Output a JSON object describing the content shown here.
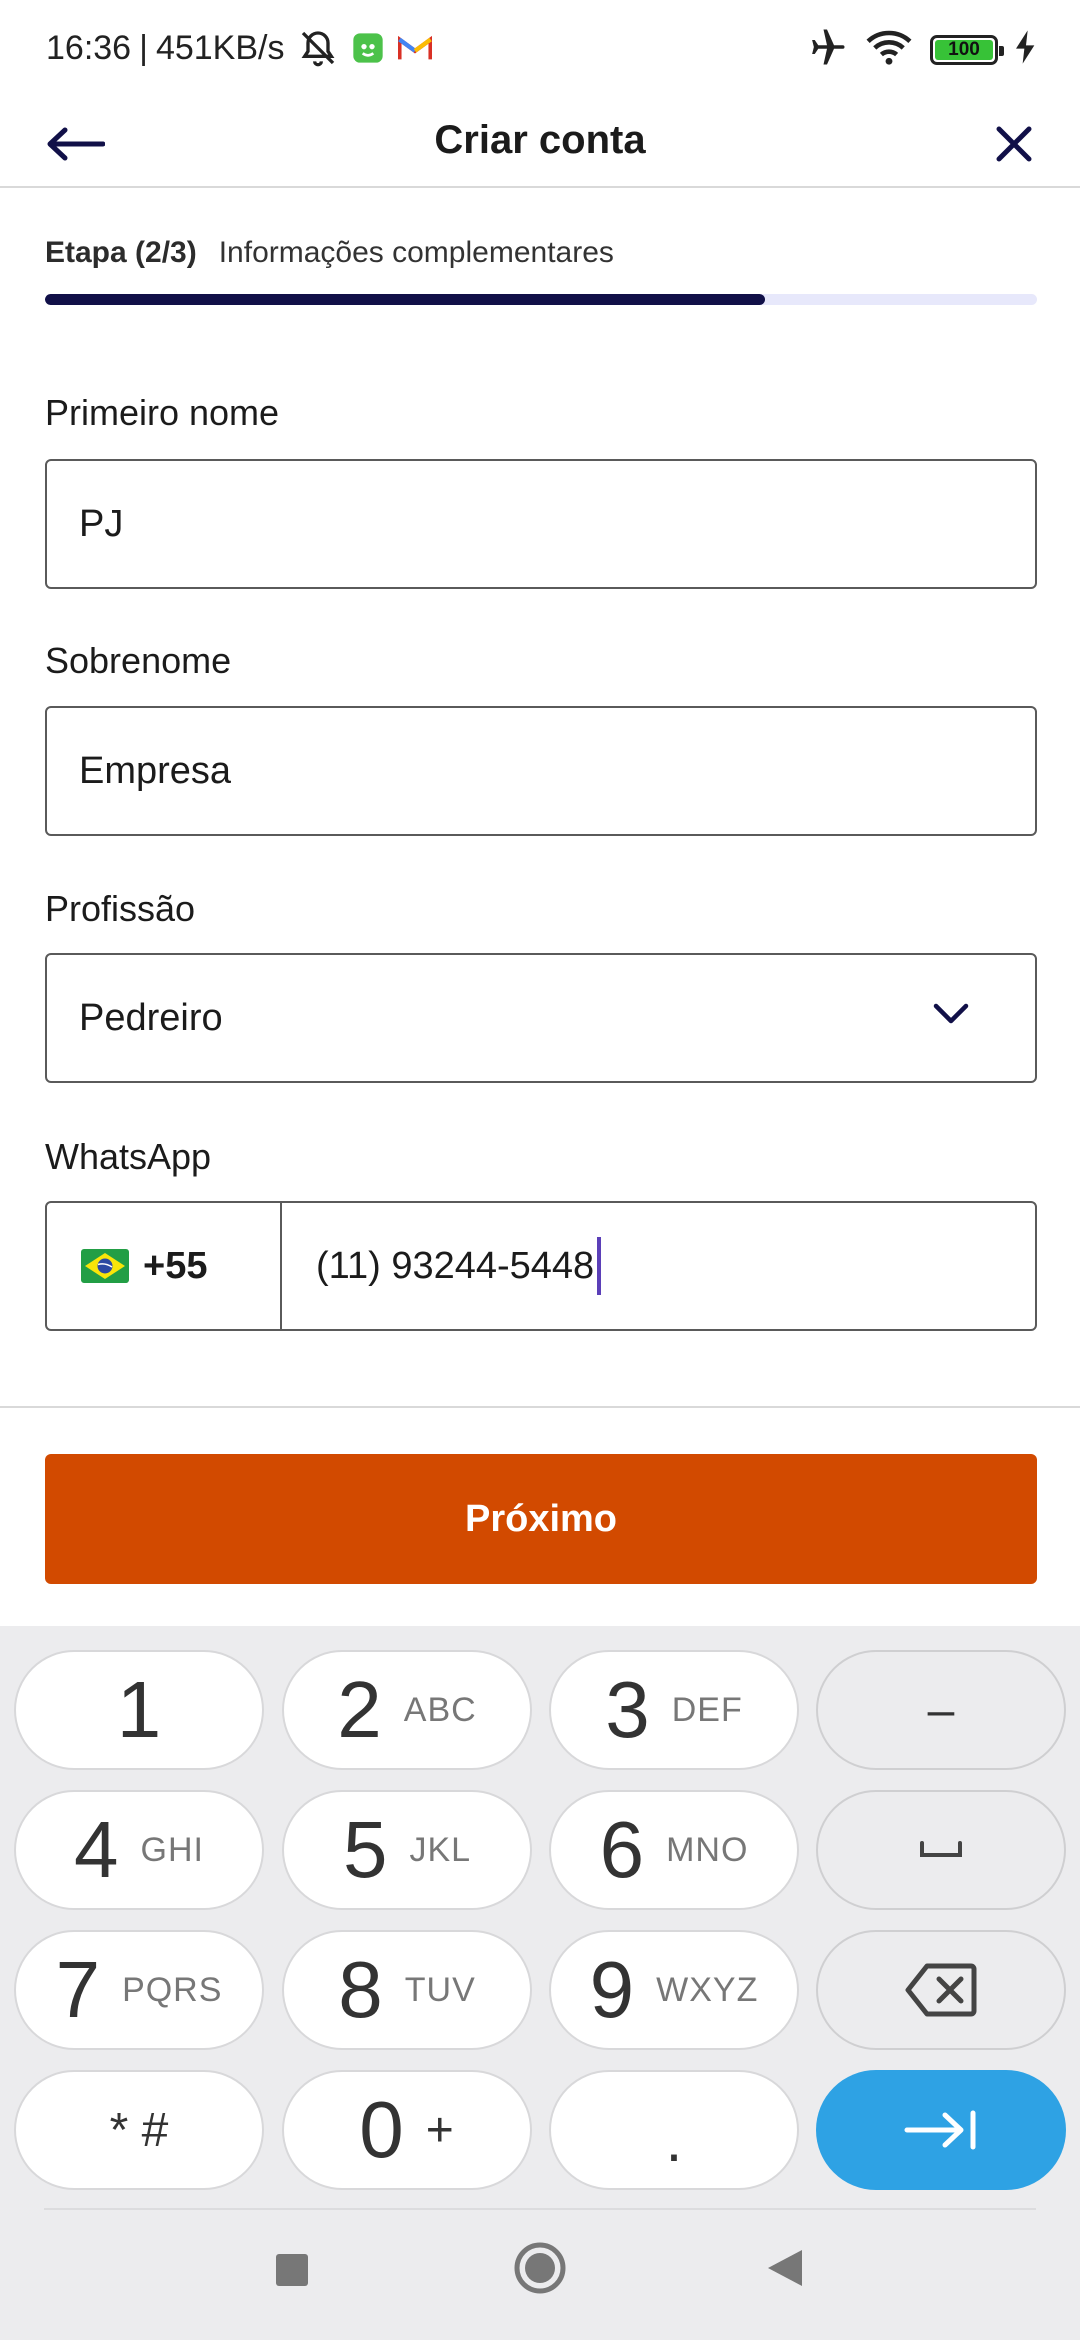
{
  "status_bar": {
    "time": "16:36",
    "network_speed": "451KB/s",
    "battery": "100",
    "battery_level": 1.0
  },
  "header": {
    "title": "Criar conta"
  },
  "step": {
    "number": "Etapa (2/3)",
    "description": "Informações complementares",
    "progress": 0.726
  },
  "form": {
    "first_name": {
      "label": "Primeiro nome",
      "value": "PJ"
    },
    "last_name": {
      "label": "Sobrenome",
      "value": "Empresa"
    },
    "profession": {
      "label": "Profissão",
      "value": "Pedreiro"
    },
    "whatsapp": {
      "label": "WhatsApp",
      "country_code": "+55",
      "number": "(11) 93244-5448"
    }
  },
  "next_button": {
    "label": "Próximo"
  },
  "keyboard": {
    "keys": [
      {
        "digit": "1",
        "letters": ""
      },
      {
        "digit": "2",
        "letters": "ABC"
      },
      {
        "digit": "3",
        "letters": "DEF"
      },
      {
        "digit": "4",
        "letters": "GHI"
      },
      {
        "digit": "5",
        "letters": "JKL"
      },
      {
        "digit": "6",
        "letters": "MNO"
      },
      {
        "digit": "7",
        "letters": "PQRS"
      },
      {
        "digit": "8",
        "letters": "TUV"
      },
      {
        "digit": "9",
        "letters": "WXYZ"
      }
    ],
    "minus": "–",
    "star_hash": "* #",
    "zero": "0",
    "plus": "+",
    "dot": "."
  },
  "colors": {
    "accent_button": "#d24a00",
    "progress_fill": "#111048",
    "keyboard_go": "#2ea2e4"
  }
}
